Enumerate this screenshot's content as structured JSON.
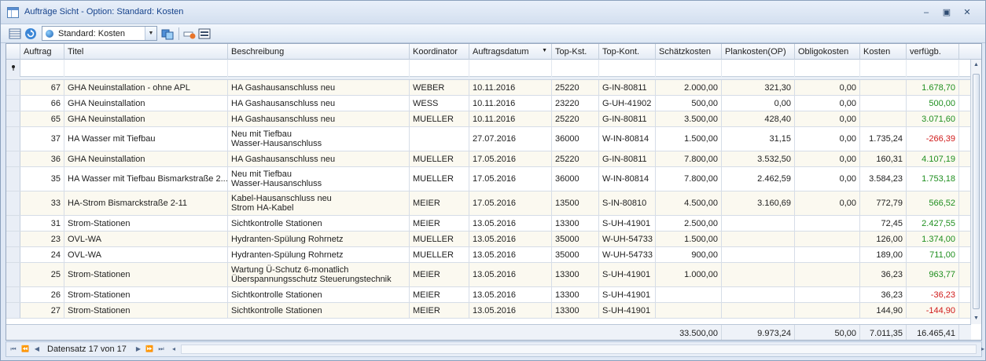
{
  "window": {
    "title": "Aufträge Sicht - Option: Standard: Kosten",
    "controls": [
      "minimize-icon",
      "restore-icon",
      "close-icon"
    ]
  },
  "toolbar": {
    "view_selector": "Standard: Kosten",
    "icons": [
      "grid-view-icon",
      "refresh-icon",
      "globe-icon",
      "switch-view-icon",
      "delete-filter-icon",
      "layout-icon"
    ]
  },
  "grid": {
    "columns": [
      "Auftrag",
      "Titel",
      "Beschreibung",
      "Koordinator",
      "Auftragsdatum",
      "Top-Kst.",
      "Top-Kont.",
      "Schätzkosten",
      "Plankosten(OP)",
      "Obligokosten",
      "Kosten",
      "verfügb."
    ],
    "sort_column": "Auftragsdatum",
    "sort_direction": "descending",
    "rows": [
      {
        "auftrag": "67",
        "titel": "GHA Neuinstallation - ohne APL",
        "beschreibung": "HA Gashausanschluss neu",
        "koordinator": "WEBER",
        "datum": "10.11.2016",
        "kst": "25220",
        "kont": "G-IN-80811",
        "schaetz": "2.000,00",
        "plan": "321,30",
        "obligo": "0,00",
        "kosten": "",
        "verf": "1.678,70",
        "neg": false
      },
      {
        "auftrag": "66",
        "titel": "GHA Neuinstallation",
        "beschreibung": "HA Gashausanschluss neu",
        "koordinator": "WESS",
        "datum": "10.11.2016",
        "kst": "23220",
        "kont": "G-UH-41902",
        "schaetz": "500,00",
        "plan": "0,00",
        "obligo": "0,00",
        "kosten": "",
        "verf": "500,00",
        "neg": false
      },
      {
        "auftrag": "65",
        "titel": "GHA Neuinstallation",
        "beschreibung": "HA Gashausanschluss neu",
        "koordinator": "MUELLER",
        "datum": "10.11.2016",
        "kst": "25220",
        "kont": "G-IN-80811",
        "schaetz": "3.500,00",
        "plan": "428,40",
        "obligo": "0,00",
        "kosten": "",
        "verf": "3.071,60",
        "neg": false
      },
      {
        "auftrag": "37",
        "titel": "HA Wasser mit Tiefbau",
        "beschreibung": "Neu mit Tiefbau\nWasser-Hausanschluss",
        "koordinator": "",
        "datum": "27.07.2016",
        "kst": "36000",
        "kont": "W-IN-80814",
        "schaetz": "1.500,00",
        "plan": "31,15",
        "obligo": "0,00",
        "kosten": "1.735,24",
        "verf": "-266,39",
        "neg": true
      },
      {
        "auftrag": "36",
        "titel": "GHA Neuinstallation",
        "beschreibung": "HA Gashausanschluss neu",
        "koordinator": "MUELLER",
        "datum": "17.05.2016",
        "kst": "25220",
        "kont": "G-IN-80811",
        "schaetz": "7.800,00",
        "plan": "3.532,50",
        "obligo": "0,00",
        "kosten": "160,31",
        "verf": "4.107,19",
        "neg": false
      },
      {
        "auftrag": "35",
        "titel": "HA Wasser mit Tiefbau Bismarkstraße 2...",
        "beschreibung": "Neu mit Tiefbau\nWasser-Hausanschluss",
        "koordinator": "MUELLER",
        "datum": "17.05.2016",
        "kst": "36000",
        "kont": "W-IN-80814",
        "schaetz": "7.800,00",
        "plan": "2.462,59",
        "obligo": "0,00",
        "kosten": "3.584,23",
        "verf": "1.753,18",
        "neg": false
      },
      {
        "auftrag": "33",
        "titel": "HA-Strom Bismarckstraße 2-11",
        "beschreibung": "Kabel-Hausanschluss neu\nStrom HA-Kabel",
        "koordinator": "MEIER",
        "datum": "17.05.2016",
        "kst": "13500",
        "kont": "S-IN-80810",
        "schaetz": "4.500,00",
        "plan": "3.160,69",
        "obligo": "0,00",
        "kosten": "772,79",
        "verf": "566,52",
        "neg": false
      },
      {
        "auftrag": "31",
        "titel": "Strom-Stationen",
        "beschreibung": "Sichtkontrolle Stationen",
        "koordinator": "MEIER",
        "datum": "13.05.2016",
        "kst": "13300",
        "kont": "S-UH-41901",
        "schaetz": "2.500,00",
        "plan": "",
        "obligo": "",
        "kosten": "72,45",
        "verf": "2.427,55",
        "neg": false
      },
      {
        "auftrag": "23",
        "titel": "OVL-WA",
        "beschreibung": "Hydranten-Spülung Rohrnetz",
        "koordinator": "MUELLER",
        "datum": "13.05.2016",
        "kst": "35000",
        "kont": "W-UH-54733",
        "schaetz": "1.500,00",
        "plan": "",
        "obligo": "",
        "kosten": "126,00",
        "verf": "1.374,00",
        "neg": false
      },
      {
        "auftrag": "24",
        "titel": "OVL-WA",
        "beschreibung": "Hydranten-Spülung Rohrnetz",
        "koordinator": "MUELLER",
        "datum": "13.05.2016",
        "kst": "35000",
        "kont": "W-UH-54733",
        "schaetz": "900,00",
        "plan": "",
        "obligo": "",
        "kosten": "189,00",
        "verf": "711,00",
        "neg": false
      },
      {
        "auftrag": "25",
        "titel": "Strom-Stationen",
        "beschreibung": "Wartung Ü-Schutz  6-monatlich\nÜberspannungsschutz Steuerungstechnik",
        "koordinator": "MEIER",
        "datum": "13.05.2016",
        "kst": "13300",
        "kont": "S-UH-41901",
        "schaetz": "1.000,00",
        "plan": "",
        "obligo": "",
        "kosten": "36,23",
        "verf": "963,77",
        "neg": false
      },
      {
        "auftrag": "26",
        "titel": "Strom-Stationen",
        "beschreibung": "Sichtkontrolle Stationen",
        "koordinator": "MEIER",
        "datum": "13.05.2016",
        "kst": "13300",
        "kont": "S-UH-41901",
        "schaetz": "",
        "plan": "",
        "obligo": "",
        "kosten": "36,23",
        "verf": "-36,23",
        "neg": true
      },
      {
        "auftrag": "27",
        "titel": "Strom-Stationen",
        "beschreibung": "Sichtkontrolle Stationen",
        "koordinator": "MEIER",
        "datum": "13.05.2016",
        "kst": "13300",
        "kont": "S-UH-41901",
        "schaetz": "",
        "plan": "",
        "obligo": "",
        "kosten": "144,90",
        "verf": "-144,90",
        "neg": true
      }
    ],
    "totals": {
      "schaetz": "33.500,00",
      "plan": "9.973,24",
      "obligo": "50,00",
      "kosten": "7.011,35",
      "verf": "16.465,41"
    }
  },
  "navigator": {
    "record_text": "Datensatz 17 von 17",
    "buttons": [
      "first-record-icon",
      "prev-page-icon",
      "prev-record-icon",
      "next-record-icon",
      "next-page-icon",
      "last-record-icon"
    ]
  },
  "colors": {
    "positive": "#1f8f1f",
    "negative": "#d01a1a",
    "alt_row": "#fbf9f0",
    "title_text": "#15428b"
  }
}
